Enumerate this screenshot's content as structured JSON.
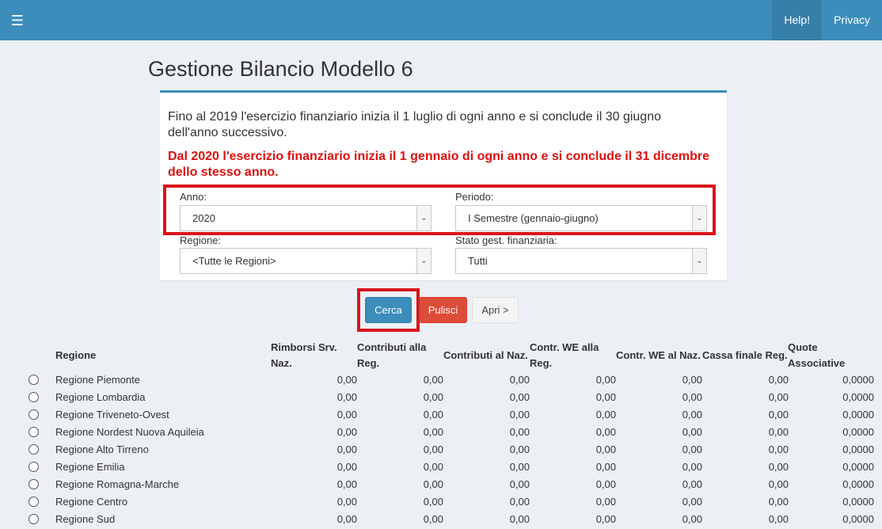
{
  "nav": {
    "help": "Help!",
    "privacy": "Privacy"
  },
  "page_title": "Gestione Bilancio Modello 6",
  "info_text": "Fino al 2019 l'esercizio finanziario inizia il 1 luglio di ogni anno e si conclude il 30 giugno dell'anno successivo.",
  "warning_text": "Dal 2020 l'esercizio finanziario inizia il 1 gennaio di ogni anno e si conclude il 31 dicembre dello stesso anno.",
  "filters": {
    "anno_label": "Anno:",
    "anno_value": "2020",
    "periodo_label": "Periodo:",
    "periodo_value": "I Semestre (gennaio-giugno)",
    "regione_label": "Regione:",
    "regione_value": "<Tutte le Regioni>",
    "stato_label": "Stato gest. finanziaria:",
    "stato_value": "Tutti"
  },
  "buttons": {
    "cerca": "Cerca",
    "pulisci": "Pulisci",
    "apri": "Apri >"
  },
  "table": {
    "headers": {
      "regione": "Regione",
      "rimborsi": [
        "Rimborsi Srv.",
        "Naz."
      ],
      "contributi_reg": [
        "Contributi alla",
        "Reg."
      ],
      "contributi_naz": "Contributi al Naz.",
      "contr_we_reg": [
        "Contr. WE alla",
        "Reg."
      ],
      "contr_we_naz": "Contr. WE al Naz.",
      "cassa": "Cassa finale Reg.",
      "quote": [
        "Quote",
        "Associative"
      ]
    },
    "rows": [
      {
        "name": "Regione Piemonte",
        "values": [
          "0,00",
          "0,00",
          "0,00",
          "0,00",
          "0,00",
          "0,00",
          "0,0000"
        ]
      },
      {
        "name": "Regione Lombardia",
        "values": [
          "0,00",
          "0,00",
          "0,00",
          "0,00",
          "0,00",
          "0,00",
          "0,0000"
        ]
      },
      {
        "name": "Regione Triveneto-Ovest",
        "values": [
          "0,00",
          "0,00",
          "0,00",
          "0,00",
          "0,00",
          "0,00",
          "0,0000"
        ]
      },
      {
        "name": "Regione Nordest Nuova Aquileia",
        "values": [
          "0,00",
          "0,00",
          "0,00",
          "0,00",
          "0,00",
          "0,00",
          "0,0000"
        ]
      },
      {
        "name": "Regione Alto Tirreno",
        "values": [
          "0,00",
          "0,00",
          "0,00",
          "0,00",
          "0,00",
          "0,00",
          "0,0000"
        ]
      },
      {
        "name": "Regione Emilia",
        "values": [
          "0,00",
          "0,00",
          "0,00",
          "0,00",
          "0,00",
          "0,00",
          "0,0000"
        ]
      },
      {
        "name": "Regione Romagna-Marche",
        "values": [
          "0,00",
          "0,00",
          "0,00",
          "0,00",
          "0,00",
          "0,00",
          "0,0000"
        ]
      },
      {
        "name": "Regione Centro",
        "values": [
          "0,00",
          "0,00",
          "0,00",
          "0,00",
          "0,00",
          "0,00",
          "0,0000"
        ]
      },
      {
        "name": "Regione Sud",
        "values": [
          "0,00",
          "0,00",
          "0,00",
          "0,00",
          "0,00",
          "0,00",
          "0,0000"
        ]
      }
    ]
  },
  "colors": {
    "header": "#3c8dbc",
    "warning": "#dd1010",
    "highlight": "#d9141b",
    "primary": "#3c8dbc",
    "danger": "#dd4b39"
  },
  "icons": {
    "menu": "hamburger-icon",
    "dropdown": "chevron-down-icon"
  }
}
